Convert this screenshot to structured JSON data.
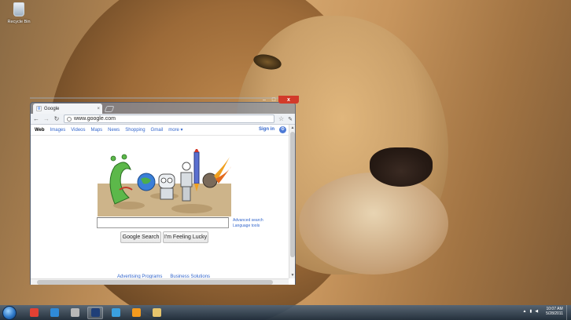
{
  "desktop": {
    "icons": [
      {
        "label": "Recycle Bin",
        "icon": "recycle-bin-icon"
      }
    ]
  },
  "browser": {
    "tab_title": "Google",
    "url": "www.google.com",
    "window_controls": {
      "minimize": "–",
      "maximize": "□",
      "close": "x"
    },
    "google": {
      "nav_links": [
        "Web",
        "Images",
        "Videos",
        "Maps",
        "News",
        "Shopping",
        "Gmail",
        "more ▾"
      ],
      "sign_in": "Sign in",
      "search_value": "",
      "advanced_search": "Advanced search",
      "language_tools": "Language tools",
      "search_button": "Google Search",
      "lucky_button": "I'm Feeling Lucky",
      "footer_links": [
        "Advertising Programs",
        "Business Solutions"
      ]
    }
  },
  "taskbar": {
    "apps": [
      {
        "name": "chrome",
        "color": "#e34133",
        "active": false
      },
      {
        "name": "internet-explorer",
        "color": "#2f8ad8",
        "active": false
      },
      {
        "name": "tools",
        "color": "#b8b8b8",
        "active": false
      },
      {
        "name": "photoshop",
        "color": "#1f3f78",
        "active": true
      },
      {
        "name": "itunes",
        "color": "#3aa0e0",
        "active": false
      },
      {
        "name": "media-player",
        "color": "#f39a1e",
        "active": false
      },
      {
        "name": "file-explorer",
        "color": "#e6c46c",
        "active": false
      }
    ],
    "clock_time": "10:07 AM",
    "clock_date": "5/28/2011"
  }
}
